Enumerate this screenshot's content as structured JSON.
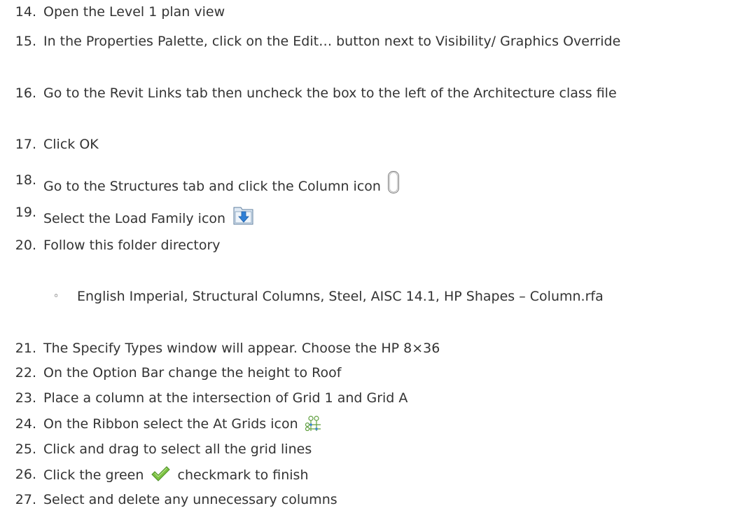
{
  "steps": [
    {
      "num": "14.",
      "text": "Open the Level 1 plan view"
    },
    {
      "num": "15.",
      "text": "In the Properties Palette, click on the Edit… button next to Visibility/ Graphics Override"
    },
    {
      "num": "16.",
      "text": "Go to the Revit Links tab then uncheck the box to the left of the Architecture class file"
    },
    {
      "num": "17.",
      "text": "Click OK"
    },
    {
      "num": "18.",
      "text": "Go to the Structures tab and click the Column icon",
      "icon": "column-icon"
    },
    {
      "num": "19.",
      "text": "Select the Load Family icon",
      "icon": "load-family-icon"
    },
    {
      "num": "20.",
      "text": "Follow this folder directory"
    },
    {
      "num": "21.",
      "text": "The Specify Types window will appear. Choose the HP 8×36"
    },
    {
      "num": "22.",
      "text": "On the Option Bar change the height to Roof"
    },
    {
      "num": "23.",
      "text": "Place a column at the intersection of Grid 1 and Grid A"
    },
    {
      "num": "24.",
      "text": "On the Ribbon select the At Grids icon",
      "icon": "at-grids-icon"
    },
    {
      "num": "25.",
      "text": "Click and drag to select all the grid lines"
    },
    {
      "num": "26.",
      "text_before": "Click the green",
      "text_after": "checkmark to finish",
      "icon": "checkmark-icon"
    },
    {
      "num": "27.",
      "text": "Select and delete any unnecessary columns"
    }
  ],
  "sub_bullet": {
    "bullet": "◦",
    "text": "English Imperial, Structural Columns, Steel, AISC 14.1, HP Shapes – Column.rfa"
  }
}
